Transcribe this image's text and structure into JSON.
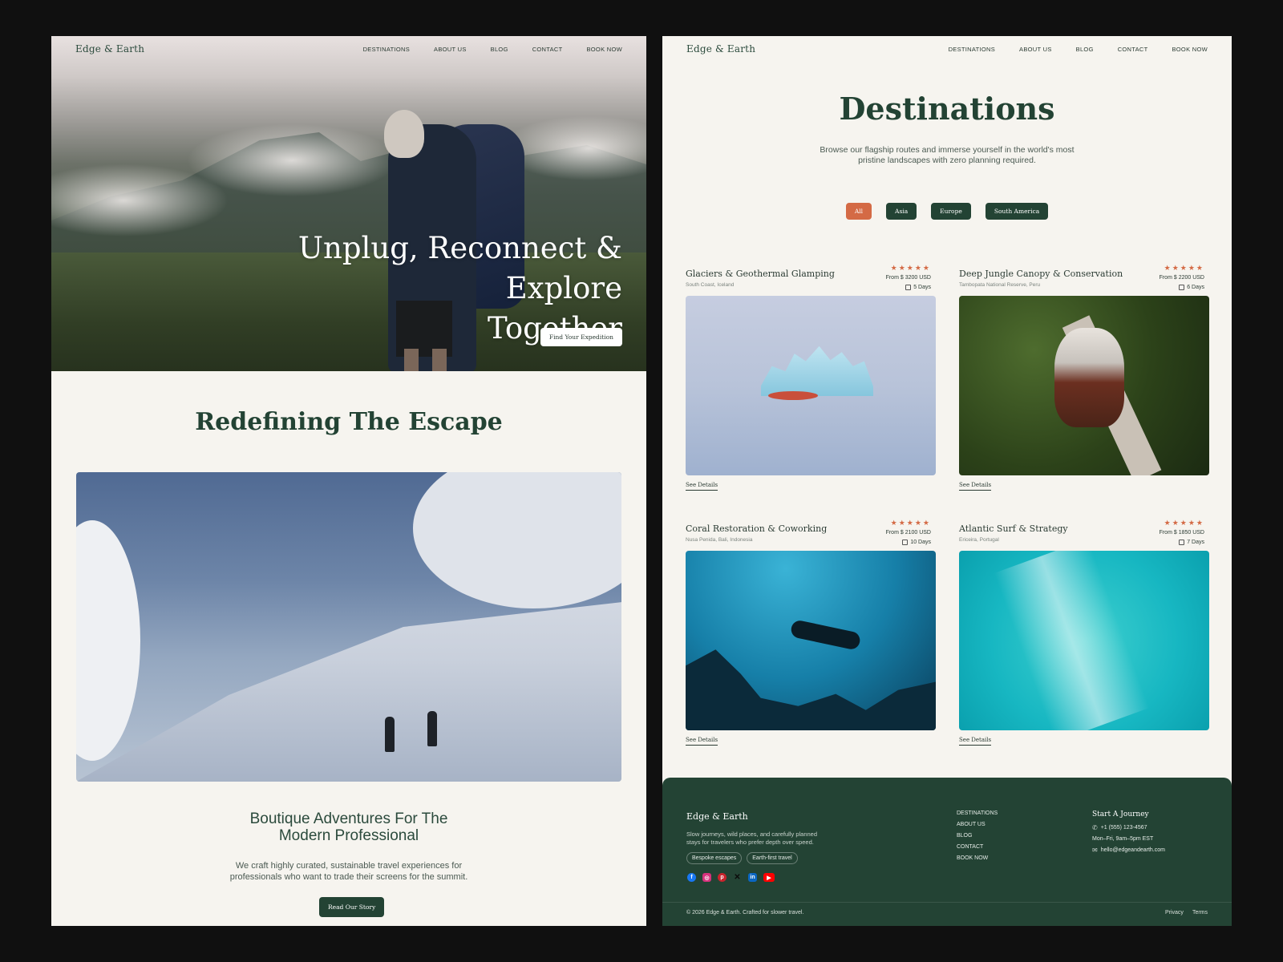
{
  "brand": "Edge & Earth",
  "nav": [
    "DESTINATIONS",
    "ABOUT US",
    "BLOG",
    "CONTACT",
    "BOOK NOW"
  ],
  "home": {
    "hero_line1": "Unplug, Reconnect & Explore",
    "hero_line2": "Together",
    "hero_button": "Find Your Expedition",
    "section_title": "Redefining The Escape",
    "subtitle_line1": "Boutique Adventures For The",
    "subtitle_line2": "Modern Professional",
    "body_line1": "We craft highly curated, sustainable travel experiences for",
    "body_line2": "professionals who want to trade their screens for the summit.",
    "story_button": "Read Our Story"
  },
  "destinations": {
    "title": "Destinations",
    "intro_line1": "Browse our flagship routes and immerse yourself in the world's most",
    "intro_line2": "pristine landscapes with zero planning required.",
    "filters": [
      "All",
      "Asia",
      "Europe",
      "South America"
    ],
    "active_filter": "All",
    "stars": "★★★★★",
    "see_details": "See Details",
    "cards": [
      {
        "title": "Glaciers & Geothermal Glamping",
        "location": "South Coast, Iceland",
        "price": "From $ 3200 USD",
        "duration": "5 Days",
        "rating": 5
      },
      {
        "title": "Deep Jungle Canopy & Conservation",
        "location": "Tambopata National Reserve, Peru",
        "price": "From $ 2200 USD",
        "duration": "6 Days",
        "rating": 5
      },
      {
        "title": "Coral Restoration & Coworking",
        "location": "Nusa Penida, Bali, Indonesia",
        "price": "From $ 2100 USD",
        "duration": "10 Days",
        "rating": 5
      },
      {
        "title": "Atlantic Surf & Strategy",
        "location": "Ericeira, Portugal",
        "price": "From $ 1850 USD",
        "duration": "7 Days",
        "rating": 5
      }
    ]
  },
  "footer": {
    "brand": "Edge & Earth",
    "desc_line1": "Slow journeys, wild places, and carefully planned",
    "desc_line2": "stays for travelers who prefer depth over speed.",
    "tags": [
      "Bespoke escapes",
      "Earth-first travel"
    ],
    "links": [
      "DESTINATIONS",
      "ABOUT US",
      "BLOG",
      "CONTACT",
      "BOOK NOW"
    ],
    "contact_title": "Start A Journey",
    "phone": "+1 (555) 123-4567",
    "hours": "Mon–Fri, 9am–5pm EST",
    "email": "hello@edgeandearth.com",
    "copyright": "© 2026 Edge & Earth. Crafted for slower travel.",
    "legal": [
      "Privacy",
      "Terms"
    ],
    "socials": [
      "facebook-icon",
      "instagram-icon",
      "pinterest-icon",
      "x-icon",
      "linkedin-icon",
      "youtube-icon"
    ]
  },
  "colors": {
    "accent": "#d46a45",
    "brand_green": "#234334",
    "background": "#f6f4ef"
  }
}
